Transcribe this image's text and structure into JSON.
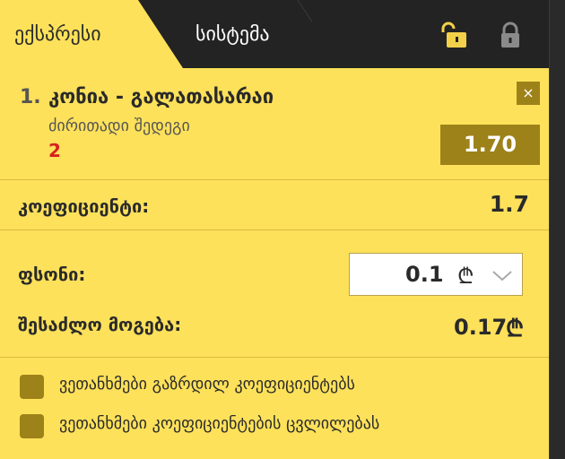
{
  "tabs": {
    "express_label": "ექსპრესი",
    "system_label": "სისტემა"
  },
  "bet": {
    "number": "1.",
    "match": "კონია - გალათასარაი",
    "market": "ძირითადი შედეგი",
    "selection": "2",
    "odd": "1.70",
    "close_symbol": "×"
  },
  "coefficient": {
    "label": "კოეფიციენტი:",
    "value": "1.7"
  },
  "stake": {
    "label": "ფსონი:",
    "value": "0.1",
    "currency": "₾"
  },
  "win": {
    "label": "შესაძლო მოგება:",
    "value": "0.17",
    "currency": "₾"
  },
  "checkboxes": [
    {
      "label": "ვეთანხმები გაზრდილ კოეფიციენტებს"
    },
    {
      "label": "ვეთანხმები კოეფიციენტების ცვლილებას"
    }
  ],
  "colors": {
    "panel": "#fde15a",
    "dark": "#232323",
    "olive": "#9c8219",
    "selection": "#d92020"
  }
}
